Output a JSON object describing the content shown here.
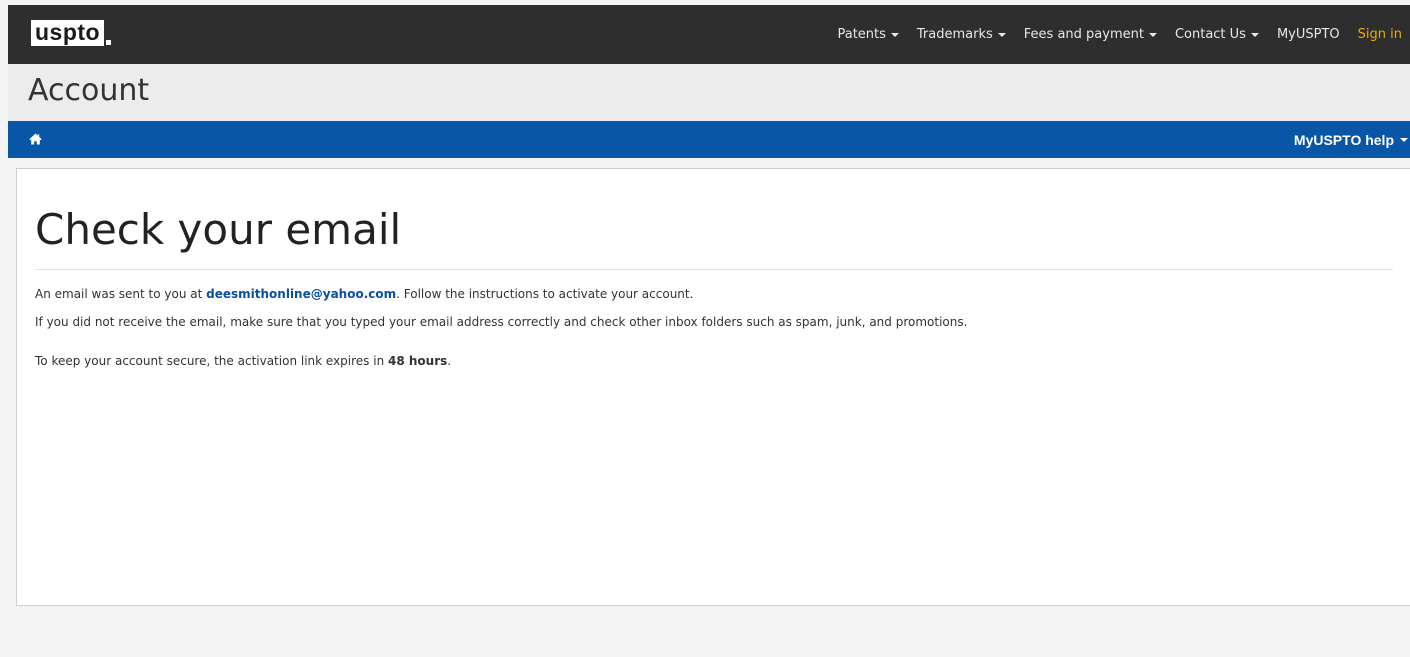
{
  "header": {
    "logo_text": "uspto",
    "nav": [
      {
        "label": "Patents",
        "has_caret": true
      },
      {
        "label": "Trademarks",
        "has_caret": true
      },
      {
        "label": "Fees and payment",
        "has_caret": true
      },
      {
        "label": "Contact Us",
        "has_caret": true
      },
      {
        "label": "MyUSPTO",
        "has_caret": false
      },
      {
        "label": "Sign in",
        "has_caret": false
      }
    ]
  },
  "page_title": "Account",
  "subnav": {
    "home_icon": "home-icon",
    "help_label": "MyUSPTO help"
  },
  "content": {
    "heading": "Check your email",
    "line1_prefix": "An email was sent to you at ",
    "email": "deesmithonline@yahoo.com",
    "line1_suffix": ". Follow the instructions to activate your account.",
    "line2": "If you did not receive the email, make sure that you typed your email address correctly and check other inbox folders such as spam, junk, and promotions.",
    "line3_prefix": "To keep your account secure, the activation link expires in ",
    "expiry": "48 hours",
    "line3_suffix": "."
  },
  "colors": {
    "topbar": "#2e2e2e",
    "title_band": "#ececec",
    "subnav": "#0a56a6",
    "signin": "#f2a900",
    "email_link": "#0a4fa0"
  }
}
